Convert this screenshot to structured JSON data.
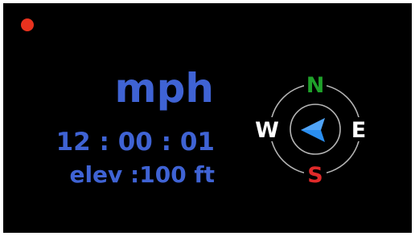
{
  "colors": {
    "background": "#000000",
    "accent": "#3f63d4",
    "record": "#e8321e",
    "north": "#1fa12a",
    "south": "#e02a2a",
    "cardinal": "#ffffff",
    "ring": "#b5b5b5",
    "heading_arrow": "#2a8ef0"
  },
  "status": {
    "record_icon": "record-dot"
  },
  "readout": {
    "speed_unit": "mph",
    "time": "12 : 00 : 01",
    "elevation": "elev :100 ft"
  },
  "compass": {
    "north": "N",
    "south": "S",
    "east": "E",
    "west": "W",
    "heading_icon": "navigation-arrow-west"
  }
}
